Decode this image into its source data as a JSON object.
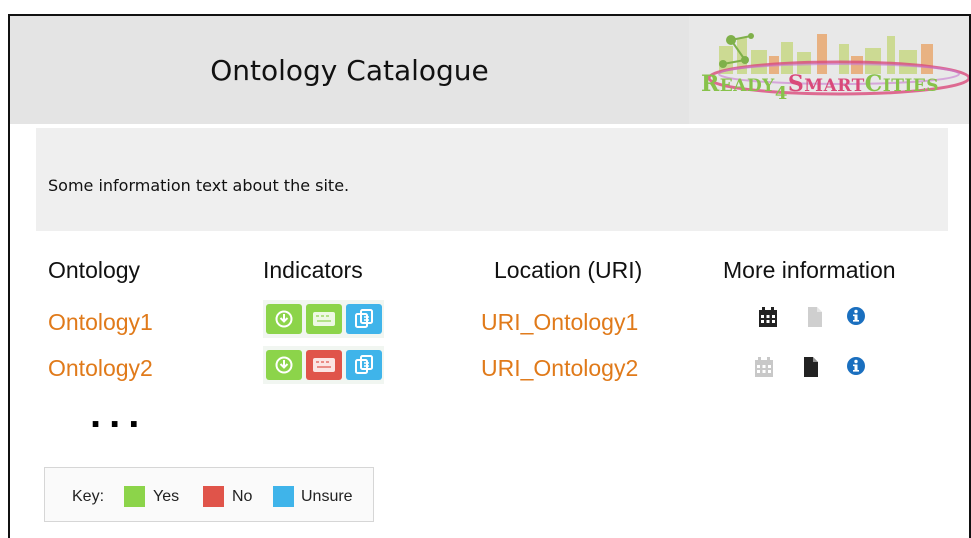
{
  "header": {
    "title": "Ontology Catalogue",
    "logo": {
      "parts": [
        "R",
        "EADY",
        "4",
        "S",
        "MART",
        "C",
        "ITIES"
      ]
    }
  },
  "info": {
    "text": "Some information text about the site."
  },
  "table": {
    "columns": [
      "Ontology",
      "Indicators",
      "Location (URI)",
      "More information"
    ],
    "rows": [
      {
        "ontology": "Ontology1",
        "uri": "URI_Ontology1",
        "indicators": [
          "yes",
          "yes",
          "unsure"
        ],
        "more_info": [
          "calendar-active",
          "document-inactive",
          "info-active"
        ]
      },
      {
        "ontology": "Ontology2",
        "uri": "URI_Ontology2",
        "indicators": [
          "yes",
          "no",
          "unsure"
        ],
        "more_info": [
          "calendar-inactive",
          "document-active",
          "info-active"
        ]
      }
    ],
    "ellipsis": "..."
  },
  "key": {
    "label": "Key:",
    "items": [
      {
        "label": "Yes",
        "color": "#8cd44a"
      },
      {
        "label": "No",
        "color": "#e0544a"
      },
      {
        "label": "Unsure",
        "color": "#3fb4ea"
      }
    ]
  },
  "colors": {
    "link": "#e07a1a",
    "yes": "#8cd44a",
    "no": "#e0544a",
    "unsure": "#3fb4ea",
    "info_blue": "#1a6fbf"
  }
}
